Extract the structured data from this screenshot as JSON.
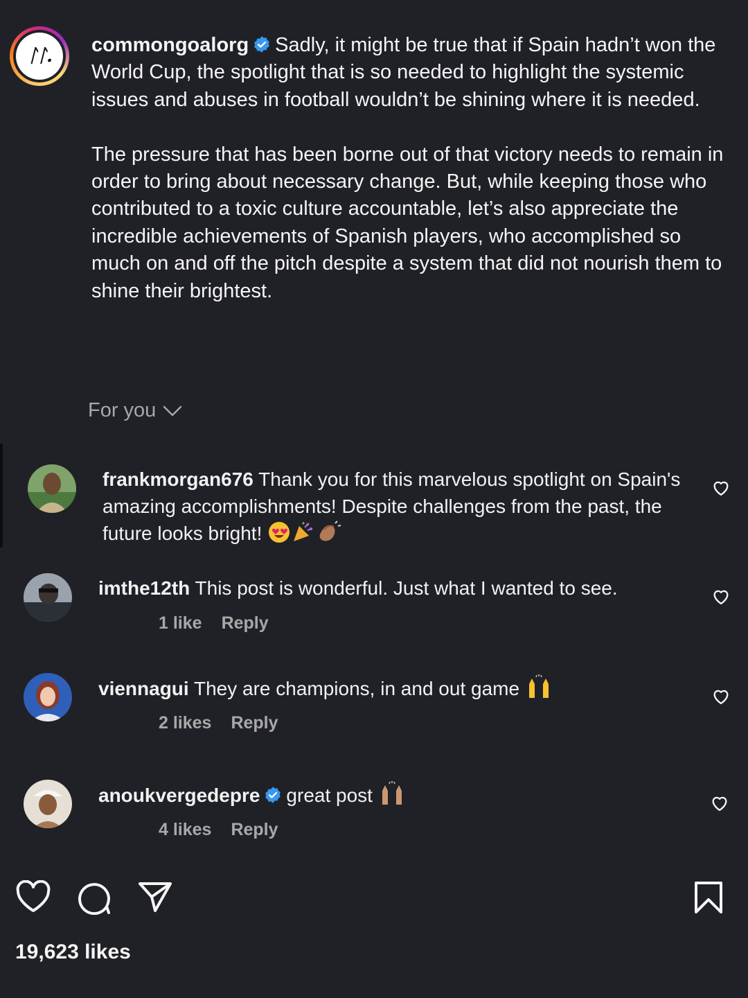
{
  "post": {
    "username": "commongoalorg",
    "avatar_label": "ᛚ",
    "caption_p1": "Sadly, it might be true that if Spain hadn’t won the World Cup, the spotlight that is so needed to highlight the systemic issues and abuses in football wouldn’t be shining where it is needed.",
    "caption_p2": "The pressure that has been borne out of that victory needs to remain in order to bring about necessary change. But, while keeping those who contributed to a toxic culture accountable, let’s also appreciate the incredible achievements of Spanish players, who accomplished so much on and off the pitch despite a system that did not nourish them to shine their brightest."
  },
  "sort": {
    "label": "For you"
  },
  "comments": [
    {
      "username": "frankmorgan676",
      "text": "Thank you for this marvelous spotlight on Spain's amazing accomplishments! Despite challenges from the past, the future looks bright!",
      "likes": "",
      "reply": ""
    },
    {
      "username": "imthe12th",
      "text": "This post is wonderful. Just what I wanted to see.",
      "likes": "1 like",
      "reply": "Reply"
    },
    {
      "username": "viennagui",
      "text": "They are champions, in and out game",
      "likes": "2 likes",
      "reply": "Reply"
    },
    {
      "username": "anoukvergedepre",
      "text": "great post",
      "likes": "4 likes",
      "reply": "Reply"
    }
  ],
  "actions": {
    "like_icon": "heart-icon",
    "comment_icon": "comment-icon",
    "share_icon": "send-icon",
    "save_icon": "bookmark-icon"
  },
  "likes_total": "19,623 likes",
  "colors": {
    "background": "#202127",
    "text": "#f5f5f5",
    "muted": "#a8a8a8",
    "verified": "#3897f0"
  }
}
